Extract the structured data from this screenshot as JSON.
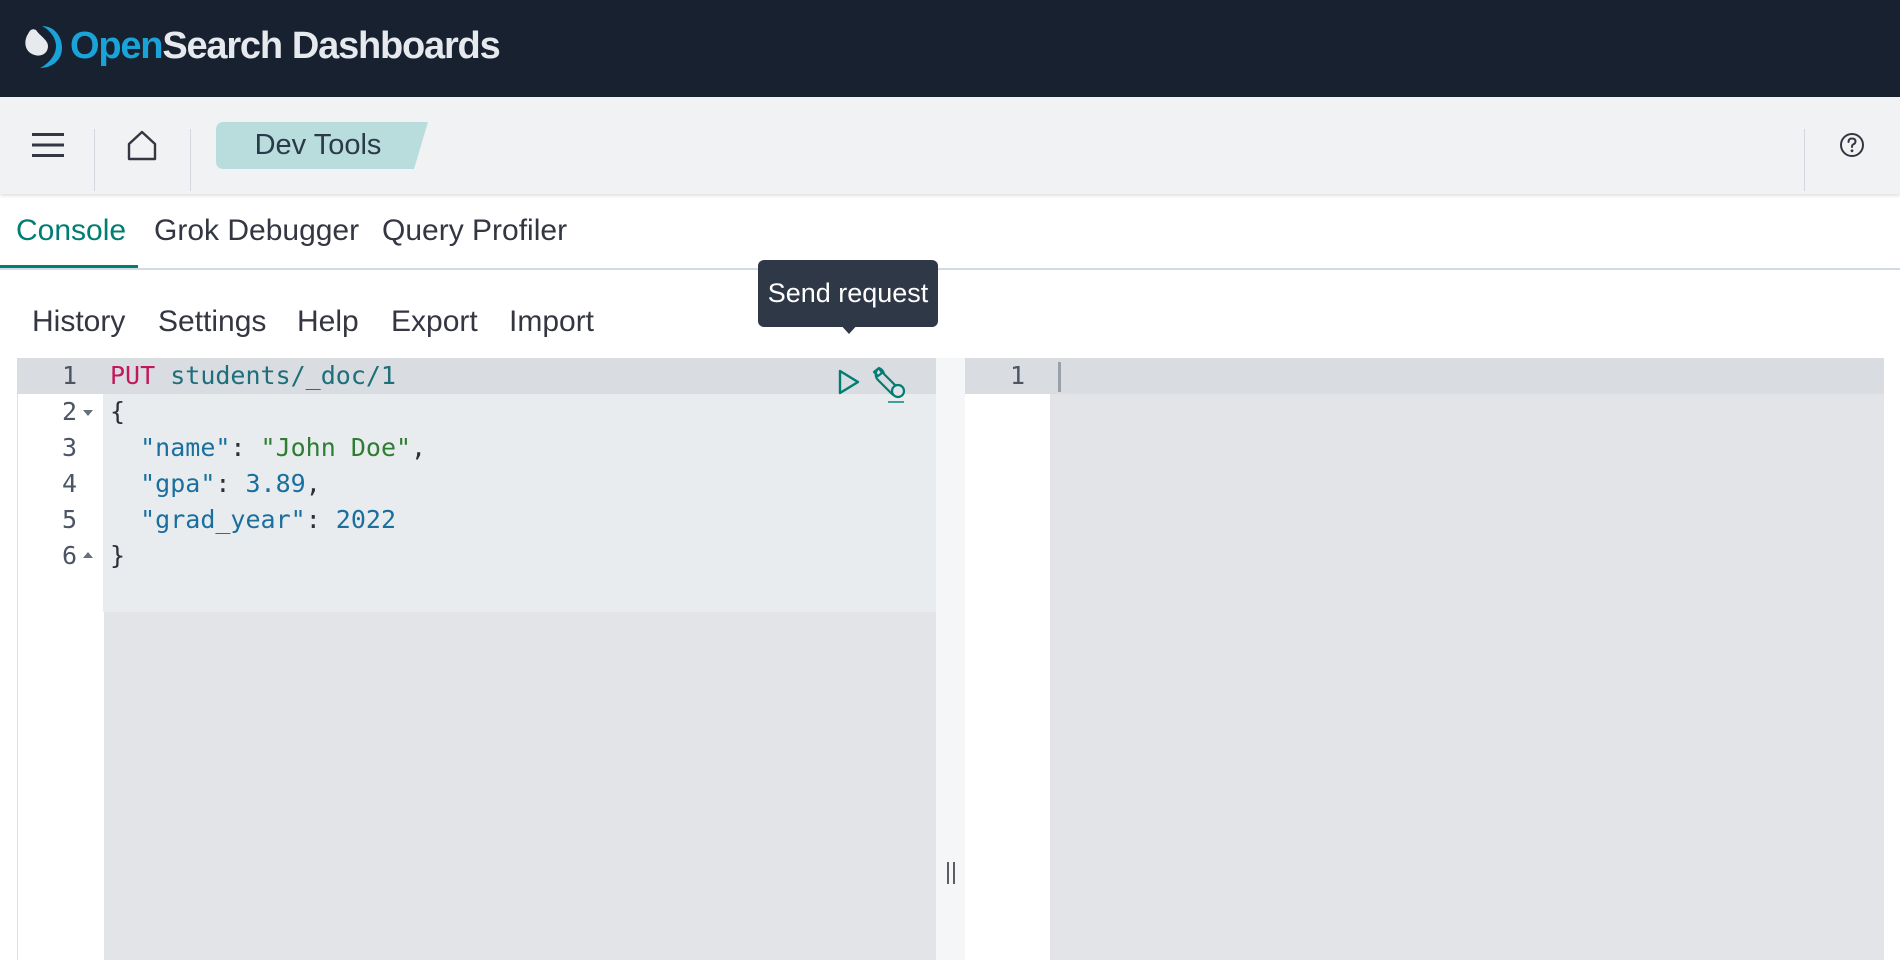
{
  "brand": {
    "name_part1": "Open",
    "name_part2": "Search",
    "name_part3": "Dashboards",
    "colors": {
      "open": "#1aa3d9",
      "text": "#e6e9ee",
      "bar": "#17212f"
    }
  },
  "header": {
    "menu_icon": "hamburger-menu-icon",
    "home_icon": "home-icon",
    "breadcrumb": "Dev Tools",
    "help_icon": "help-circle-icon"
  },
  "app_tabs": [
    {
      "label": "Console",
      "active": true
    },
    {
      "label": "Grok Debugger",
      "active": false
    },
    {
      "label": "Query Profiler",
      "active": false
    }
  ],
  "console_menu": [
    "History",
    "Settings",
    "Help",
    "Export",
    "Import"
  ],
  "tooltip": {
    "text": "Send request"
  },
  "request_editor": {
    "line_numbers": [
      "1",
      "2",
      "3",
      "4",
      "5",
      "6"
    ],
    "lines": [
      {
        "method": "PUT",
        "path": "students/_doc/1"
      },
      {
        "text": "{"
      },
      {
        "key": "\"name\"",
        "value": "\"John Doe\"",
        "trail": ","
      },
      {
        "key": "\"gpa\"",
        "value": "3.89",
        "trail": ","
      },
      {
        "key": "\"grad_year\"",
        "value": "2022",
        "trail": ""
      },
      {
        "text": "}"
      }
    ],
    "actions": [
      "play-icon",
      "wrench-icon"
    ]
  },
  "response_editor": {
    "line_numbers": [
      "1"
    ]
  },
  "accent_color": "#017d73"
}
